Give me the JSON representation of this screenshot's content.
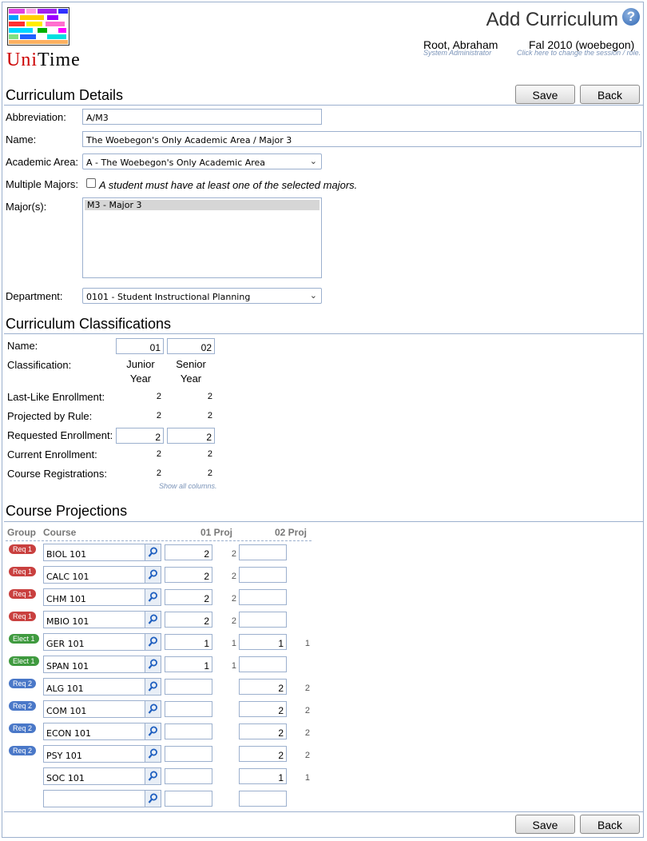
{
  "header": {
    "title": "Add Curriculum",
    "logo_first": "Uni",
    "logo_second": "Time",
    "user_name": "Root, Abraham",
    "user_role": "System Administrator",
    "session": "Fal 2010 (woebegon)",
    "session_hint": "Click here to change the session / role."
  },
  "buttons": {
    "save": "Save",
    "back": "Back"
  },
  "details": {
    "section_title": "Curriculum Details",
    "abbreviation_label": "Abbreviation:",
    "abbreviation_value": "A/M3",
    "name_label": "Name:",
    "name_value": "The Woebegon's Only Academic Area / Major 3",
    "area_label": "Academic Area:",
    "area_value": "A - The Woebegon's Only Academic Area",
    "multiple_label": "Multiple Majors:",
    "multiple_text": "A student must have at least one of the selected majors.",
    "majors_label": "Major(s):",
    "majors_selected": "M3 - Major 3",
    "department_label": "Department:",
    "department_value": "0101 - Student Instructional Planning"
  },
  "classifications": {
    "section_title": "Curriculum Classifications",
    "labels": {
      "name": "Name:",
      "classification": "Classification:",
      "last_like": "Last-Like Enrollment:",
      "projected": "Projected by Rule:",
      "requested": "Requested Enrollment:",
      "current": "Current Enrollment:",
      "registrations": "Course Registrations:"
    },
    "columns": [
      {
        "name": "01",
        "line1": "Junior",
        "line2": "Year",
        "last_like": "2",
        "projected": "2",
        "requested": "2",
        "current": "2",
        "registrations": "2"
      },
      {
        "name": "02",
        "line1": "Senior",
        "line2": "Year",
        "last_like": "2",
        "projected": "2",
        "requested": "2",
        "current": "2",
        "registrations": "2"
      }
    ],
    "show_all": "Show all columns."
  },
  "projections": {
    "section_title": "Course Projections",
    "head_group": "Group",
    "head_course": "Course",
    "head_01": "01 Proj",
    "head_02": "02 Proj",
    "rows": [
      {
        "group": "Req 1",
        "course": "BIOL 101",
        "v01": "2",
        "p01": "2",
        "v02": "",
        "p02": ""
      },
      {
        "group": "Req 1",
        "course": "CALC 101",
        "v01": "2",
        "p01": "2",
        "v02": "",
        "p02": ""
      },
      {
        "group": "Req 1",
        "course": "CHM 101",
        "v01": "2",
        "p01": "2",
        "v02": "",
        "p02": ""
      },
      {
        "group": "Req 1",
        "course": "MBIO 101",
        "v01": "2",
        "p01": "2",
        "v02": "",
        "p02": ""
      },
      {
        "group": "Elect 1",
        "course": "GER 101",
        "v01": "1",
        "p01": "1",
        "v02": "1",
        "p02": "1"
      },
      {
        "group": "Elect 1",
        "course": "SPAN 101",
        "v01": "1",
        "p01": "1",
        "v02": "",
        "p02": ""
      },
      {
        "group": "Req 2",
        "course": "ALG 101",
        "v01": "",
        "p01": "",
        "v02": "2",
        "p02": "2"
      },
      {
        "group": "Req 2",
        "course": "COM 101",
        "v01": "",
        "p01": "",
        "v02": "2",
        "p02": "2"
      },
      {
        "group": "Req 2",
        "course": "ECON 101",
        "v01": "",
        "p01": "",
        "v02": "2",
        "p02": "2"
      },
      {
        "group": "Req 2",
        "course": "PSY 101",
        "v01": "",
        "p01": "",
        "v02": "2",
        "p02": "2"
      },
      {
        "group": "",
        "course": "SOC 101",
        "v01": "",
        "p01": "",
        "v02": "1",
        "p02": "1"
      },
      {
        "group": "",
        "course": "",
        "v01": "",
        "p01": "",
        "v02": "",
        "p02": ""
      }
    ]
  },
  "colors": {
    "border": "#9cb0ce",
    "req1": "#c9403f",
    "elect1": "#3f9a3f",
    "req2": "#4a78c8"
  }
}
